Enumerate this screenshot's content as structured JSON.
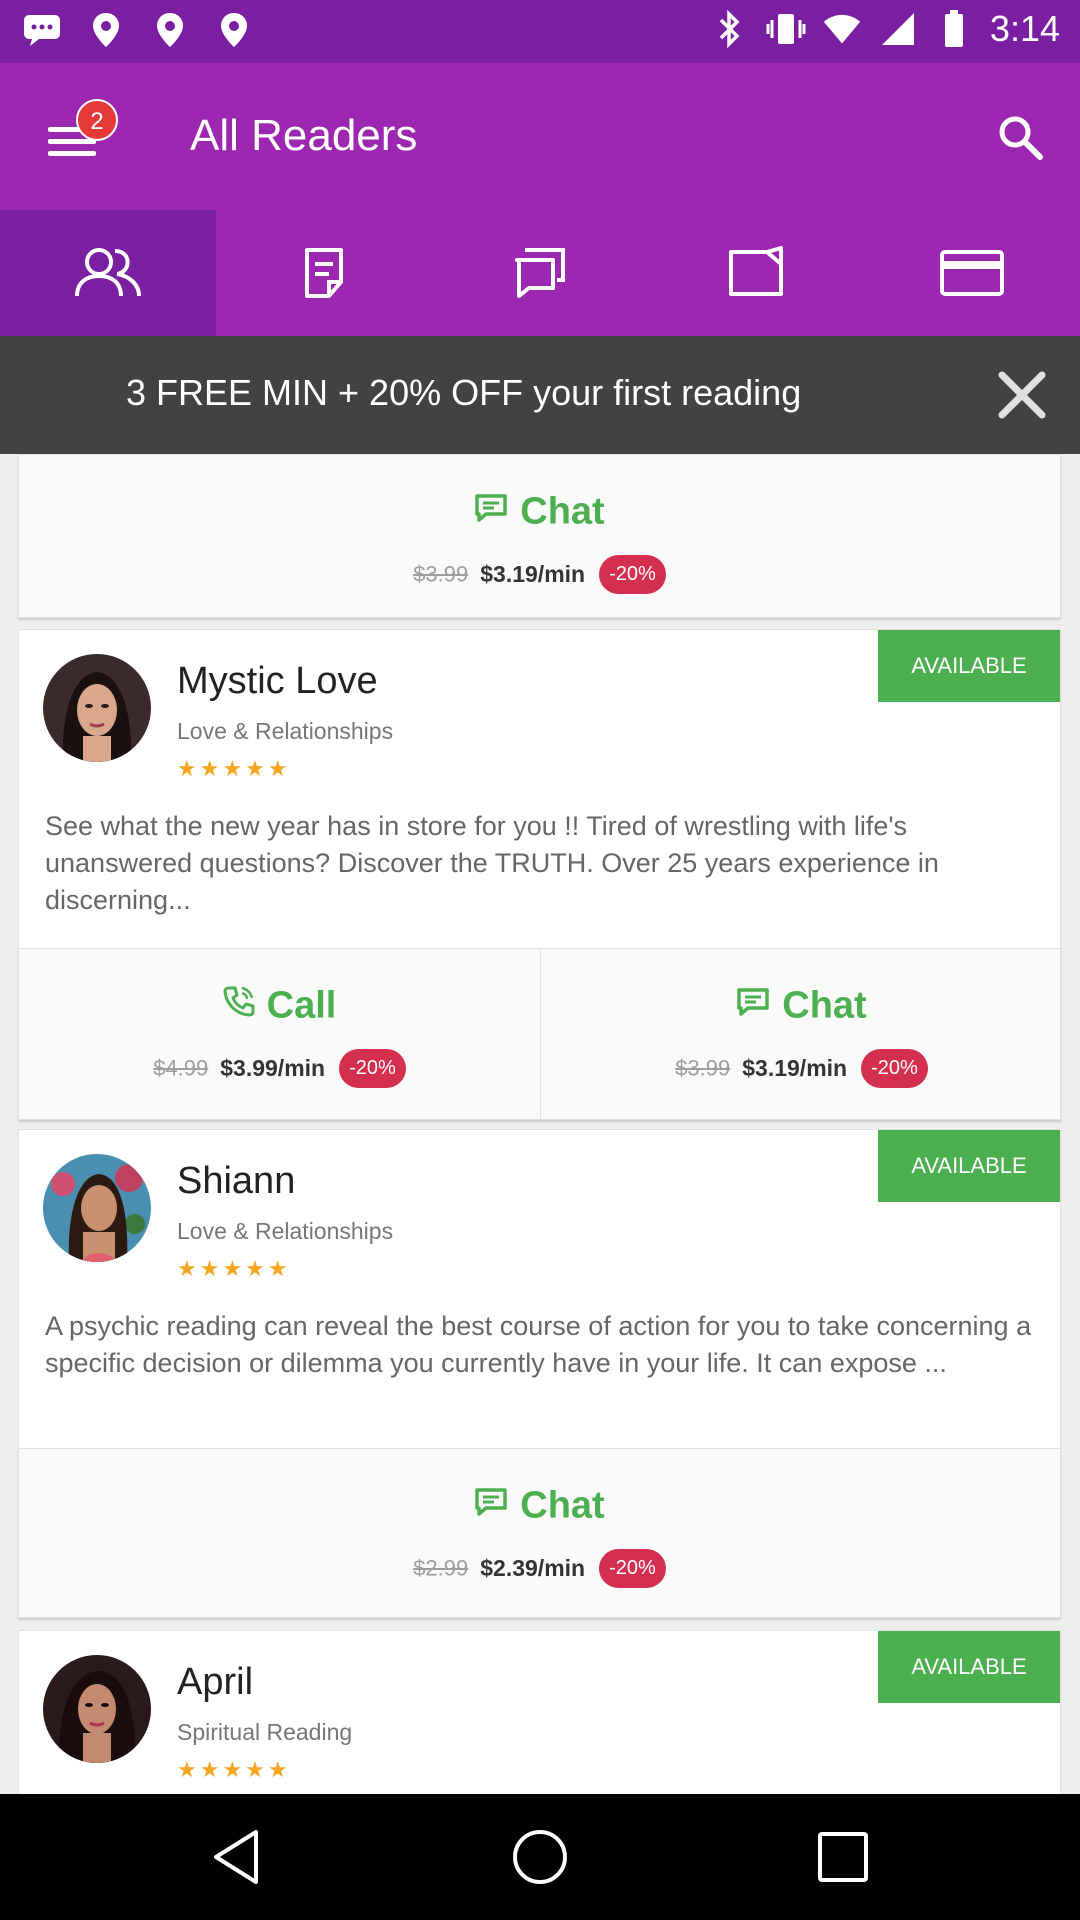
{
  "status_bar": {
    "time": "3:14"
  },
  "app_bar": {
    "title": "All Readers",
    "notification_count": "2"
  },
  "tabs": [
    {
      "icon": "readers-icon",
      "active": true
    },
    {
      "icon": "notes-icon",
      "active": false
    },
    {
      "icon": "messages-icon",
      "active": false
    },
    {
      "icon": "folder-icon",
      "active": false
    },
    {
      "icon": "credit-card-icon",
      "active": false
    }
  ],
  "promo": {
    "text": "3 FREE MIN + 20% OFF your first reading"
  },
  "top_chat": {
    "label": "Chat",
    "old_price": "$3.99",
    "new_price": "$3.19/min",
    "discount": "-20%"
  },
  "readers": [
    {
      "name": "Mystic Love",
      "category": "Love & Relationships",
      "stars": "★★★★★",
      "status": "AVAILABLE",
      "description": "See what the new year has in store for you !! Tired of wrestling with life's unanswered questions? Discover the TRUTH. Over 25 years experience in discerning...",
      "call": {
        "label": "Call",
        "old_price": "$4.99",
        "new_price": "$3.99/min",
        "discount": "-20%"
      },
      "chat": {
        "label": "Chat",
        "old_price": "$3.99",
        "new_price": "$3.19/min",
        "discount": "-20%"
      }
    },
    {
      "name": "Shiann",
      "category": "Love & Relationships",
      "stars": "★★★★★",
      "status": "AVAILABLE",
      "description": "A psychic reading can reveal the best course of action for you to take concerning a specific decision or dilemma you currently have in your life. It can expose ...",
      "chat": {
        "label": "Chat",
        "old_price": "$2.99",
        "new_price": "$2.39/min",
        "discount": "-20%"
      }
    },
    {
      "name": "April",
      "category": "Spiritual Reading",
      "stars": "★★★★★",
      "status": "AVAILABLE"
    }
  ],
  "colors": {
    "primary": "#9c27b0",
    "primary_dark": "#7b1fa2",
    "accent_green": "#4caf50",
    "discount_red": "#d32f4f",
    "promo_bg": "#424242"
  }
}
